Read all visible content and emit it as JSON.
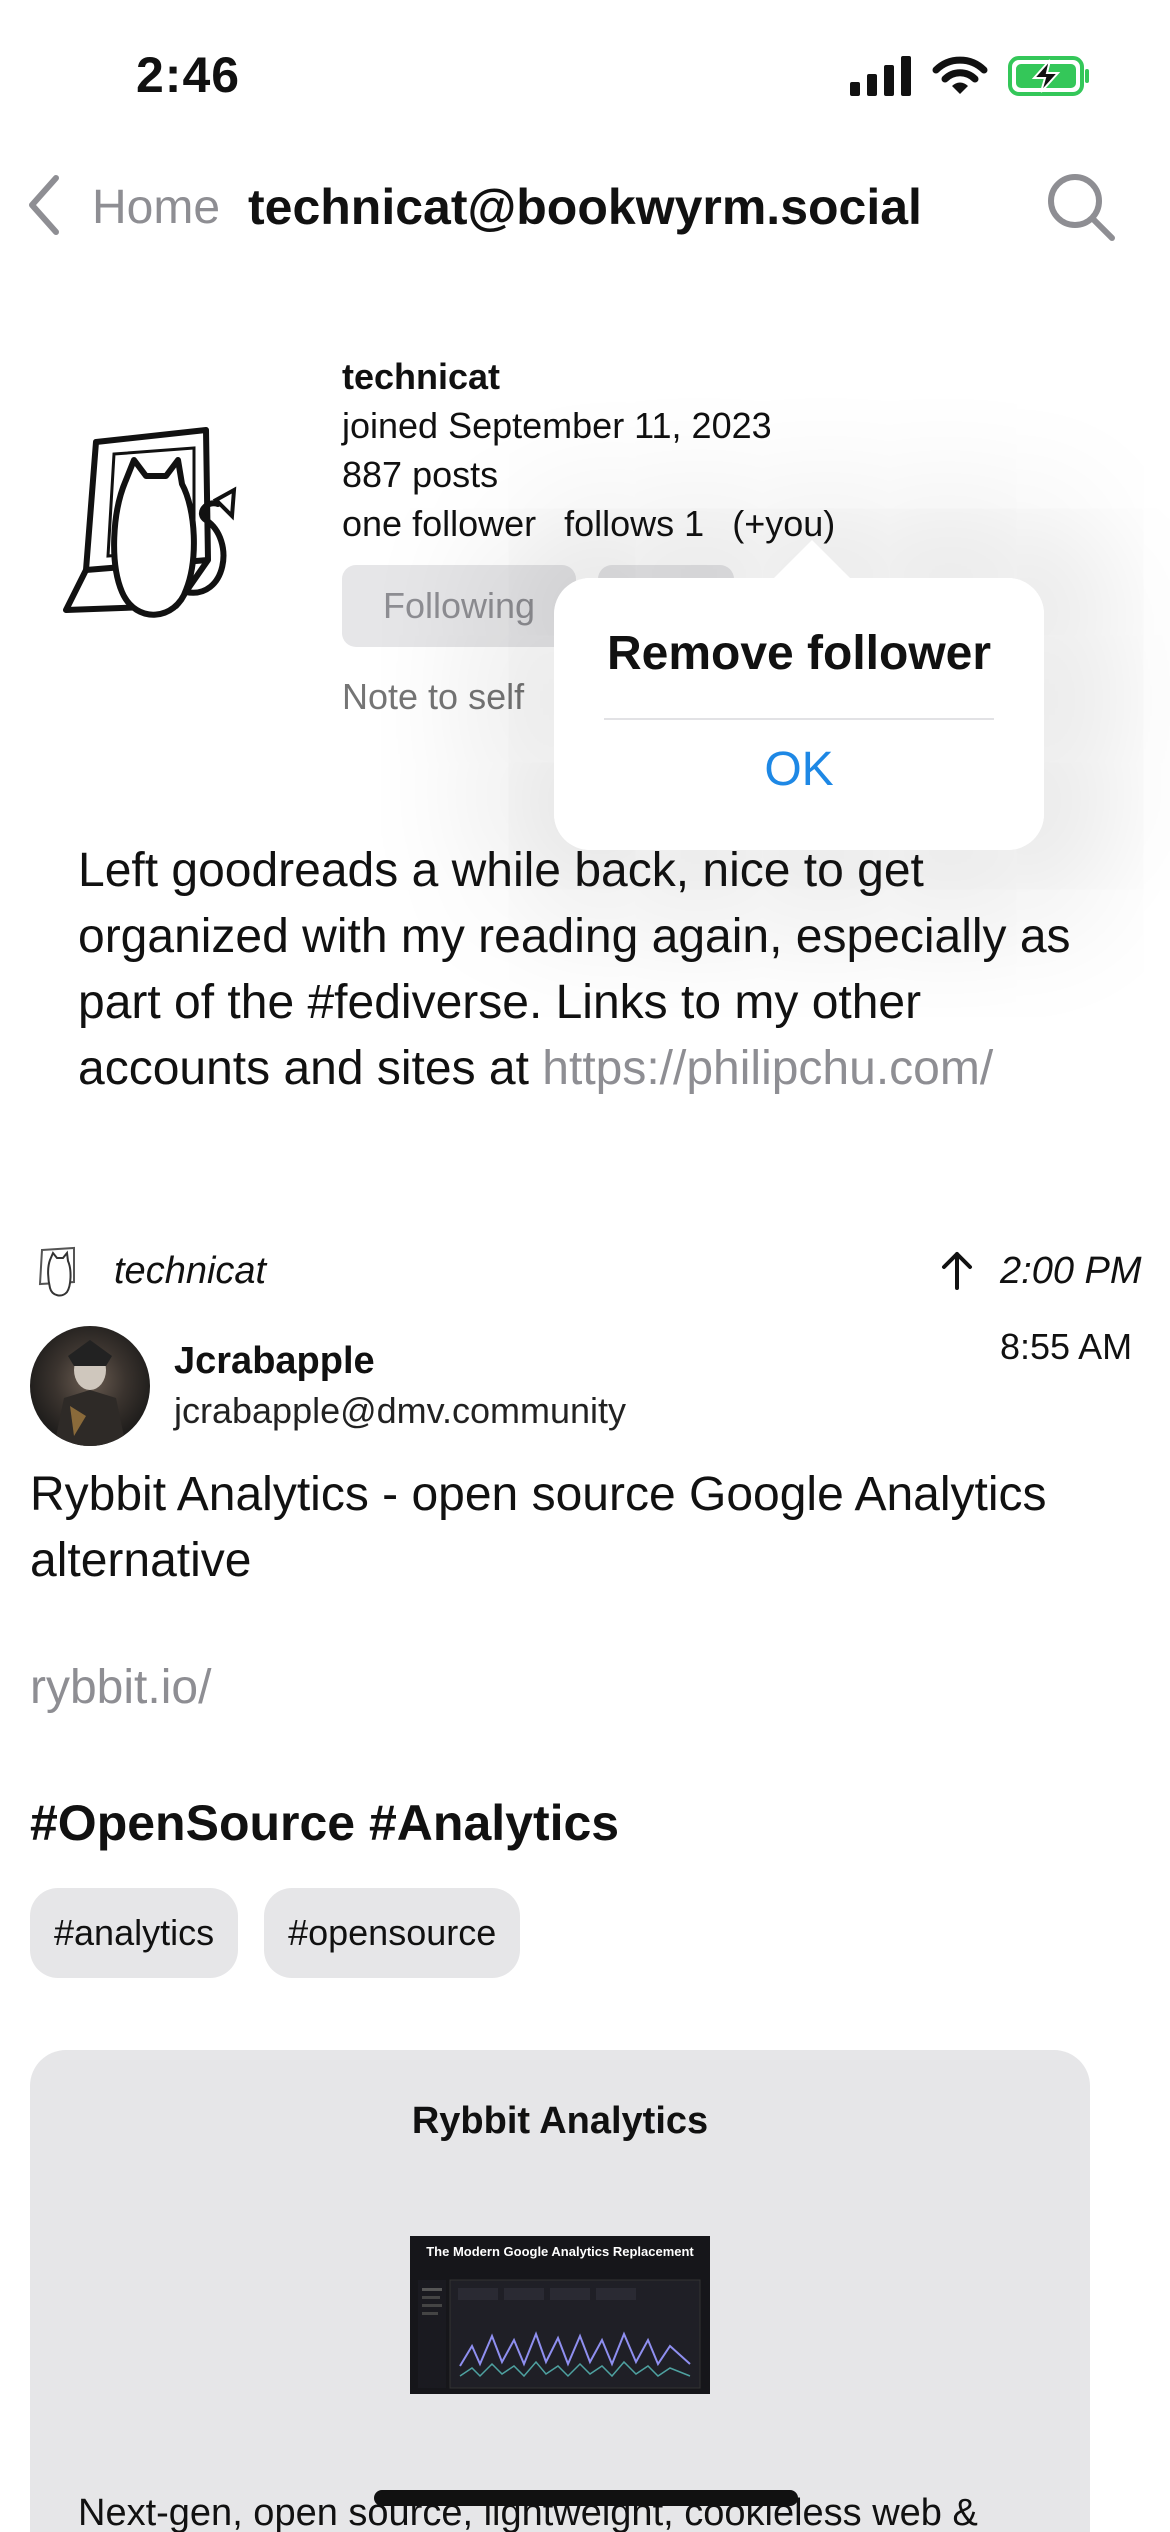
{
  "status_bar": {
    "time": "2:46",
    "icons": [
      "signal-icon",
      "wifi-icon",
      "battery-charging-icon"
    ],
    "battery_color": "#34c759"
  },
  "nav": {
    "back_label": "Home",
    "title": "technicat@bookwyrm.social",
    "icons": [
      "chevron-left-icon",
      "search-icon"
    ]
  },
  "profile": {
    "name": "technicat",
    "joined": "joined September 11, 2023",
    "posts": "887 posts",
    "followers": "one follower",
    "follows": "follows 1",
    "follows_you": "(+you)",
    "following_button": "Following",
    "note_placeholder": "Note to self",
    "bio_text": "Left goodreads a while back, nice to get organized with my reading again, especially as part of the #fediverse. Links to my other accounts and sites at ",
    "bio_link": "https://philipchu.com/"
  },
  "popover": {
    "title": "Remove follower",
    "ok_label": "OK",
    "ok_color": "#1e88e5"
  },
  "post": {
    "boosted_by": "technicat",
    "boost_time": "2:00 PM",
    "author_name": "Jcrabapple",
    "author_handle": "jcrabapple@dmv.community",
    "time": "8:55 AM",
    "text": "Rybbit Analytics - open source Google Analytics alternative",
    "link": "rybbit.io/",
    "hashtags": "#OpenSource #Analytics",
    "tags": [
      "#analytics",
      "#opensource"
    ],
    "card": {
      "title": "Rybbit Analytics",
      "image_heading": "The Modern Google Analytics Replacement",
      "description": "Next-gen, open source, lightweight, cookieless web &"
    }
  }
}
